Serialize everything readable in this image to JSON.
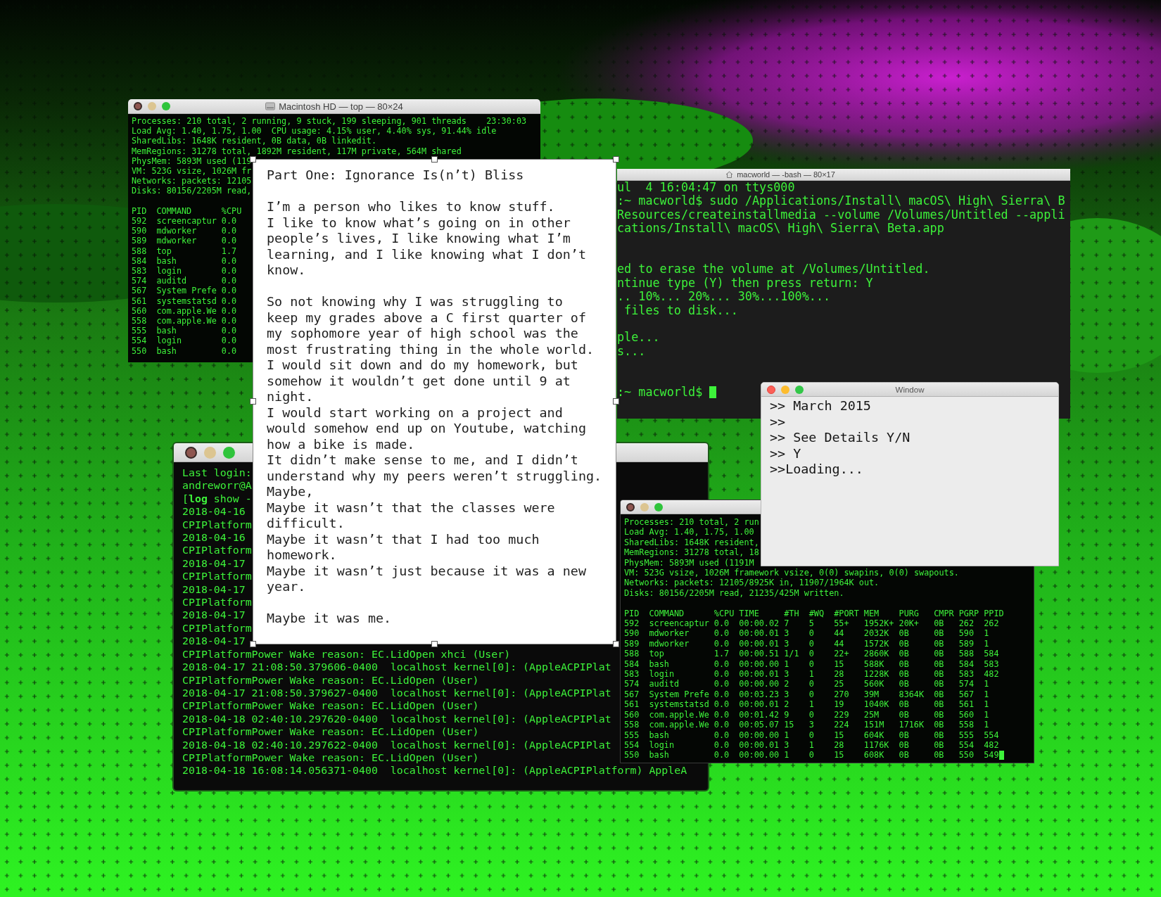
{
  "top_window": {
    "title": "Macintosh HD — top — 80×24",
    "focused": false,
    "summary": [
      "Processes: 210 total, 2 running, 9 stuck, 199 sleeping, 901 threads    23:30:03",
      "Load Avg: 1.40, 1.75, 1.00  CPU usage: 4.15% user, 4.40% sys, 91.44% idle",
      "SharedLibs: 1648K resident, 0B data, 0B linkedit.",
      "MemRegions: 31278 total, 1892M resident, 117M private, 564M shared",
      "PhysMem: 5893M used (119",
      "VM: 523G vsize, 1026M fr",
      "Networks: packets: 12105",
      "Disks: 80156/2205M read,"
    ],
    "table": {
      "columns": [
        "PID",
        "COMMAND",
        "%CPU"
      ],
      "rows": [
        [
          "592",
          "screencaptur",
          "0.0"
        ],
        [
          "590",
          "mdworker",
          "0.0"
        ],
        [
          "589",
          "mdworker",
          "0.0"
        ],
        [
          "588",
          "top",
          "1.7"
        ],
        [
          "584",
          "bash",
          "0.0"
        ],
        [
          "583",
          "login",
          "0.0"
        ],
        [
          "574",
          "auditd",
          "0.0"
        ],
        [
          "567",
          "System Prefe",
          "0.0"
        ],
        [
          "561",
          "systemstatsd",
          "0.0"
        ],
        [
          "560",
          "com.apple.We",
          "0.0"
        ],
        [
          "558",
          "com.apple.We",
          "0.0"
        ],
        [
          "555",
          "bash",
          "0.0"
        ],
        [
          "554",
          "login",
          "0.0"
        ],
        [
          "550",
          "bash",
          "0.0"
        ]
      ]
    }
  },
  "document": {
    "title": "Part One: Ignorance Is(n’t) Bliss",
    "paragraphs": [
      [
        "I’m a person who likes to know stuff.",
        "I like to know what’s going on in other",
        "people’s lives, I like knowing what I’m",
        "learning, and I like knowing what I don’t",
        "know."
      ],
      [
        "So not knowing why I was struggling to",
        "keep my grades above a C first quarter of",
        "my sophomore year of high school was the",
        "most frustrating thing in the whole world.",
        "I would sit down and do my homework, but",
        "somehow it wouldn’t get done until 9 at",
        "night.",
        "I would start working on a project and",
        "would somehow end up on Youtube, watching",
        "how a bike is made.",
        "It didn’t make sense to me, and I didn’t",
        "understand why my peers weren’t struggling.",
        "Maybe,",
        "Maybe it wasn’t that the classes were",
        "difficult.",
        "Maybe it wasn’t that I had too much",
        "homework.",
        "Maybe it wasn’t just because it was a new",
        "year."
      ],
      [
        "Maybe it was me."
      ]
    ]
  },
  "bash_window": {
    "title": "macworld — -bash — 80×17",
    "lines": [
      {
        "kind": "text",
        "text": "ul  4 16:04:47 on ttys000"
      },
      {
        "kind": "text",
        "text": ":~ macworld$ sudo /Applications/Install\\ macOS\\ High\\ Sierra\\ B"
      },
      {
        "kind": "text",
        "text": "Resources/createinstallmedia --volume /Volumes/Untitled --appli"
      },
      {
        "kind": "text",
        "text": "cations/Install\\ macOS\\ High\\ Sierra\\ Beta.app"
      },
      {
        "kind": "blank"
      },
      {
        "kind": "blank"
      },
      {
        "kind": "text",
        "text": "ed to erase the volume at /Volumes/Untitled."
      },
      {
        "kind": "text",
        "text": "ntinue type (Y) then press return: Y"
      },
      {
        "kind": "text",
        "text": ".. 10%... 20%... 30%...100%..."
      },
      {
        "kind": "text",
        "text": " files to disk..."
      },
      {
        "kind": "blank"
      },
      {
        "kind": "text",
        "text": "ple..."
      },
      {
        "kind": "text",
        "text": "s..."
      },
      {
        "kind": "blank"
      },
      {
        "kind": "blank"
      },
      {
        "kind": "text",
        "text": ":~ macworld$ ",
        "cursor": true
      }
    ]
  },
  "log_window": {
    "focused": false,
    "lines": [
      "Last login:",
      "andreworr@A",
      "[**log** show --",
      "2018-04-16",
      "CPIPlatform",
      "2018-04-16",
      "CPIPlatform",
      "2018-04-17",
      "CPIPlatform",
      "2018-04-17",
      "CPIPlatform",
      "2018-04-17",
      "CPIPlatform",
      "2018-04-17",
      "CPIPlatformPower Wake reason: EC.LidOpen xhci (User)",
      "2018-04-17 21:08:50.379606-0400  localhost kernel[0]: (AppleACPIPlat",
      "CPIPlatformPower Wake reason: EC.LidOpen (User)",
      "2018-04-17 21:08:50.379627-0400  localhost kernel[0]: (AppleACPIPlat",
      "CPIPlatformPower Wake reason: EC.LidOpen (User)",
      "2018-04-18 02:40:10.297620-0400  localhost kernel[0]: (AppleACPIPlat",
      "CPIPlatformPower Wake reason: EC.LidOpen (User)",
      "2018-04-18 02:40:10.297622-0400  localhost kernel[0]: (AppleACPIPlat",
      "CPIPlatformPower Wake reason: EC.LidOpen (User)",
      "2018-04-18 16:08:14.056371-0400  localhost kernel[0]: (AppleACPIPlatform) AppleA"
    ]
  },
  "top_window_2": {
    "focused": false,
    "summary": [
      "Processes: 210 total, 2 run",
      "Load Avg: 1.40, 1.75, 1.00",
      "SharedLibs: 1648K resident,",
      "MemRegions: 31278 total, 18",
      "PhysMem: 5893M used (1191M",
      "VM: 523G vsize, 1026M framework vsize, 0(0) swapins, 0(0) swapouts.",
      "Networks: packets: 12105/8925K in, 11907/1964K out.",
      "Disks: 80156/2205M read, 21235/425M written."
    ],
    "table": {
      "columns": [
        "PID",
        "COMMAND",
        "%CPU",
        "TIME",
        "#TH",
        "#WQ",
        "#PORT",
        "MEM",
        "PURG",
        "CMPR",
        "PGRP",
        "PPID"
      ],
      "rows": [
        [
          "592",
          "screencaptur",
          "0.0",
          "00:00.02",
          "7",
          "5",
          "55+",
          "1952K+",
          "20K+",
          "0B",
          "262",
          "262"
        ],
        [
          "590",
          "mdworker",
          "0.0",
          "00:00.01",
          "3",
          "0",
          "44",
          "2032K",
          "0B",
          "0B",
          "590",
          "1"
        ],
        [
          "589",
          "mdworker",
          "0.0",
          "00:00.01",
          "3",
          "0",
          "44",
          "1572K",
          "0B",
          "0B",
          "589",
          "1"
        ],
        [
          "588",
          "top",
          "1.7",
          "00:00.51",
          "1/1",
          "0",
          "22+",
          "2860K",
          "0B",
          "0B",
          "588",
          "584"
        ],
        [
          "584",
          "bash",
          "0.0",
          "00:00.00",
          "1",
          "0",
          "15",
          "588K",
          "0B",
          "0B",
          "584",
          "583"
        ],
        [
          "583",
          "login",
          "0.0",
          "00:00.01",
          "3",
          "1",
          "28",
          "1228K",
          "0B",
          "0B",
          "583",
          "482"
        ],
        [
          "574",
          "auditd",
          "0.0",
          "00:00.00",
          "2",
          "0",
          "25",
          "560K",
          "0B",
          "0B",
          "574",
          "1"
        ],
        [
          "567",
          "System Prefe",
          "0.0",
          "00:03.23",
          "3",
          "0",
          "270",
          "39M",
          "8364K",
          "0B",
          "567",
          "1"
        ],
        [
          "561",
          "systemstatsd",
          "0.0",
          "00:00.01",
          "2",
          "1",
          "19",
          "1040K",
          "0B",
          "0B",
          "561",
          "1"
        ],
        [
          "560",
          "com.apple.We",
          "0.0",
          "00:01.42",
          "9",
          "0",
          "229",
          "25M",
          "0B",
          "0B",
          "560",
          "1"
        ],
        [
          "558",
          "com.apple.We",
          "0.0",
          "00:05.07",
          "15",
          "3",
          "224",
          "151M",
          "1716K",
          "0B",
          "558",
          "1"
        ],
        [
          "555",
          "bash",
          "0.0",
          "00:00.00",
          "1",
          "0",
          "15",
          "604K",
          "0B",
          "0B",
          "555",
          "554"
        ],
        [
          "554",
          "login",
          "0.0",
          "00:00.01",
          "3",
          "1",
          "28",
          "1176K",
          "0B",
          "0B",
          "554",
          "482"
        ],
        [
          "550",
          "bash",
          "0.0",
          "00:00.00",
          "1",
          "0",
          "15",
          "608K",
          "0B",
          "0B",
          "550",
          "549"
        ]
      ],
      "cursor": true
    }
  },
  "prompt_window": {
    "title": "Window",
    "focused": true,
    "lines": [
      ">> March 2015",
      ">>",
      ">> See Details Y/N",
      ">> Y",
      ">>Loading..."
    ]
  }
}
